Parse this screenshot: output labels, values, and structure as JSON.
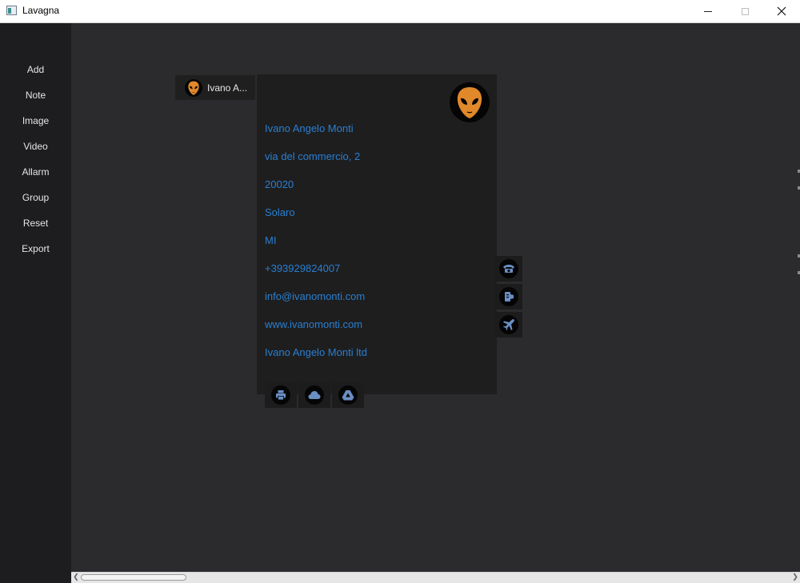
{
  "window": {
    "title": "Lavagna"
  },
  "sidebar": {
    "items": [
      {
        "label": "Add"
      },
      {
        "label": "Note"
      },
      {
        "label": "Image"
      },
      {
        "label": "Video"
      },
      {
        "label": "Allarm"
      },
      {
        "label": "Group"
      },
      {
        "label": "Reset"
      },
      {
        "label": "Export"
      }
    ]
  },
  "tab": {
    "label": "Ivano A..."
  },
  "card": {
    "name": "Ivano Angelo Monti",
    "address": "via del commercio, 2",
    "zip": "20020",
    "city": "Solaro",
    "province": "MI",
    "phone": "+393929824007",
    "email": "info@ivanomonti.com",
    "website": "www.ivanomonti.com",
    "company": "Ivano Angelo Monti ltd"
  },
  "icons": {
    "avatar": "alien-head-icon",
    "phone": "phone-icon",
    "contact": "contact-card-icon",
    "flight": "airplane-icon",
    "print": "print-icon",
    "cloud": "cloud-icon",
    "drive": "drive-icon"
  },
  "colors": {
    "accent": "#2a7fd0",
    "avatar_orange": "#e0882a",
    "icon_blue": "#6a8fc4",
    "background": "#2b2b2e",
    "sidebar": "#1d1d1f",
    "card": "#1e1e1f"
  }
}
